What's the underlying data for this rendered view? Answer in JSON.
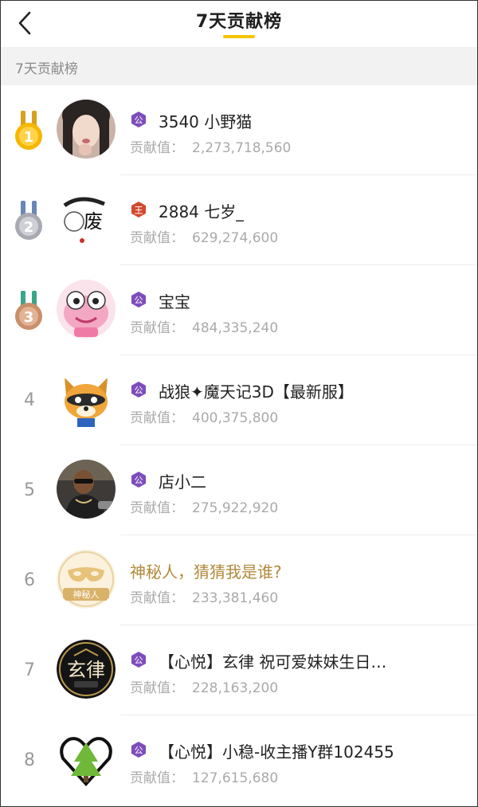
{
  "header": {
    "title": "7天贡献榜",
    "back_icon": "back-arrow-icon"
  },
  "section": {
    "label": "7天贡献榜"
  },
  "contribution_label": "贡献值：",
  "colors": {
    "accent": "#f5c400",
    "mystery_name": "#b08a3a",
    "badge_purple": "#7c4dbb",
    "badge_red": "#d24a2e"
  },
  "rows": [
    {
      "rank": "1",
      "medal": "gold",
      "badge": "purple",
      "badge_text": "公",
      "name": "3540 小野猫",
      "value": "2,273,718,560",
      "avatar": "photo-avatar"
    },
    {
      "rank": "2",
      "medal": "silver",
      "badge": "red",
      "badge_text": "王",
      "name": "2884  七岁_",
      "value": "629,274,600",
      "avatar": "calligraphy-avatar"
    },
    {
      "rank": "3",
      "medal": "bronze",
      "badge": "purple",
      "badge_text": "公",
      "name": "宝宝",
      "value": "484,335,240",
      "avatar": "cartoon-avatar"
    },
    {
      "rank": "4",
      "medal": "",
      "badge": "purple",
      "badge_text": "公",
      "name": "战狼✦魔天记3D【最新服】",
      "value": "400,375,800",
      "avatar": "raccoon-avatar"
    },
    {
      "rank": "5",
      "medal": "",
      "badge": "purple",
      "badge_text": "公",
      "name": "店小二",
      "value": "275,922,920",
      "avatar": "photo-avatar"
    },
    {
      "rank": "6",
      "medal": "",
      "badge": "",
      "badge_text": "",
      "name": "神秘人，猜猜我是谁?",
      "value": "233,381,460",
      "avatar": "mask-avatar",
      "avatar_text": "神秘人"
    },
    {
      "rank": "7",
      "medal": "",
      "badge": "purple",
      "badge_text": "公",
      "name": "【心悦】玄律 祝可爱妹妹生日…",
      "value": "228,163,200",
      "avatar": "logo-avatar",
      "avatar_text": "玄律"
    },
    {
      "rank": "8",
      "medal": "",
      "badge": "purple",
      "badge_text": "公",
      "name": "【心悦】小稳-收主播Y群102455",
      "value": "127,615,680",
      "avatar": "tree-avatar"
    }
  ]
}
